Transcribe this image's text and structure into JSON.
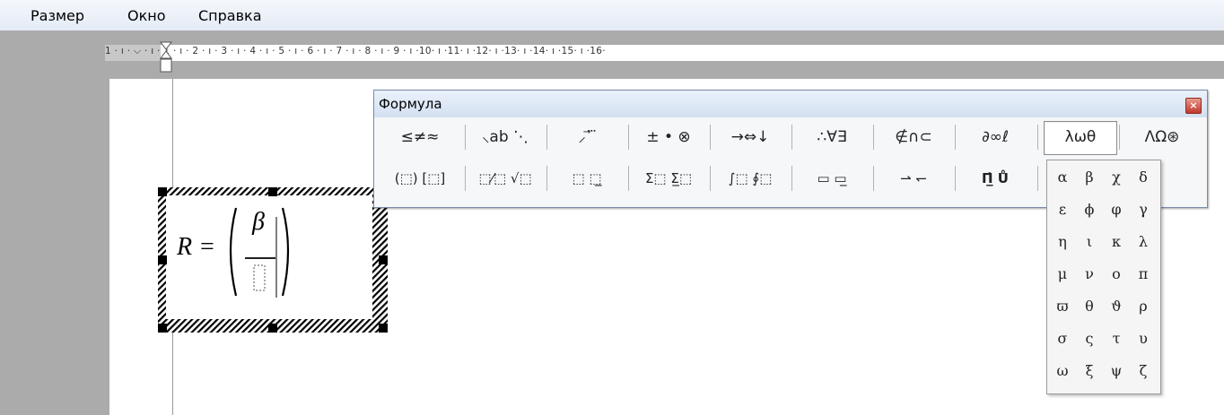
{
  "menu": {
    "items": [
      "Размер",
      "Окно",
      "Справка"
    ]
  },
  "ruler": {
    "text": "1 · ı · ⌵ · ı · 1 · ı · 2 · ı · 3 · ı · 4 · ı · 5 · ı · 6 · ı · 7 · ı · 8 · ı · 9 · ı ·10· ı ·11· ı ·12· ı ·13· ı ·14· ı ·15· ı ·16·"
  },
  "formula": {
    "lhs": "R",
    "eq": "=",
    "numerator": "β"
  },
  "toolbar": {
    "title": "Формула",
    "close": "×",
    "row1": [
      "≤≠≈",
      "⸜ab ⋱",
      "⸝ ⃗ ⃛",
      "± • ⊗",
      "→⇔↓",
      "∴∀∃",
      "∉∩⊂",
      "∂∞ℓ",
      "λωθ",
      "ΛΩ⊛"
    ],
    "row2": [
      "(⬚) [⬚]",
      "⬚⁄⬚ √⬚",
      "⬚ ⬚̲",
      "Σ⬚ Σ̲⬚",
      "∫⬚ ∮⬚",
      "▭ ▭̲",
      "⇀ ↽",
      "Π̲̇ Ů",
      "",
      ""
    ]
  },
  "greek_palette": {
    "rows": [
      [
        "α",
        "β",
        "χ",
        "δ"
      ],
      [
        "ε",
        "ϕ",
        "φ",
        "γ"
      ],
      [
        "η",
        "ι",
        "κ",
        "λ"
      ],
      [
        "μ",
        "ν",
        "ο",
        "π"
      ],
      [
        "ϖ",
        "θ",
        "ϑ",
        "ρ"
      ],
      [
        "σ",
        "ς",
        "τ",
        "υ"
      ],
      [
        "ω",
        "ξ",
        "ψ",
        "ζ"
      ]
    ]
  }
}
